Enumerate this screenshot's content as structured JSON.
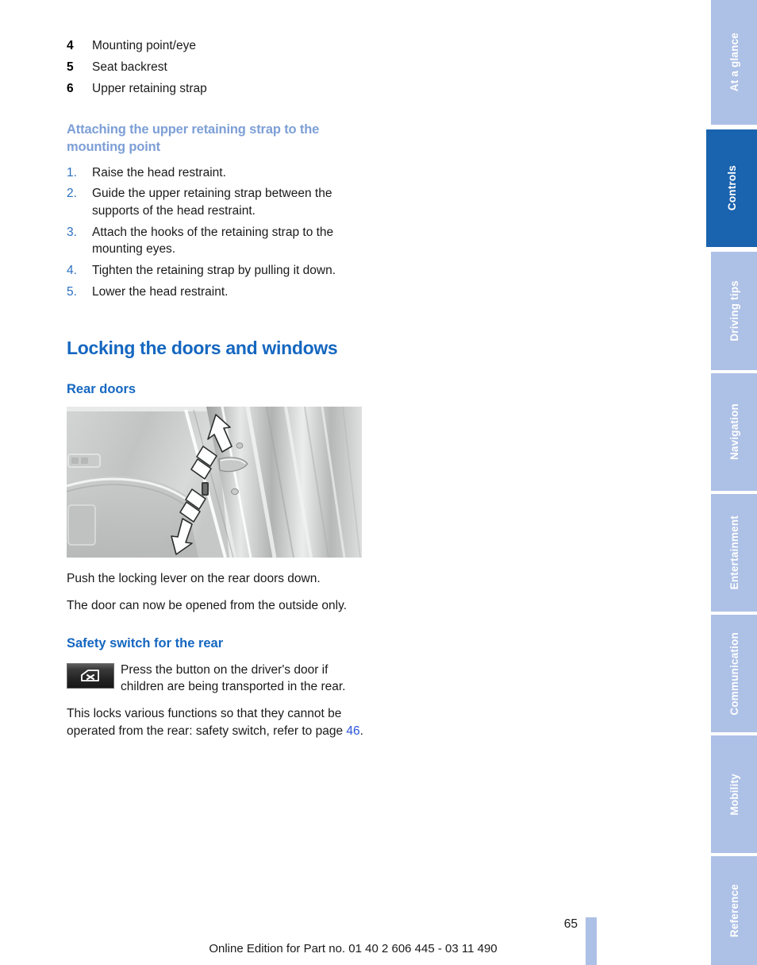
{
  "document": {
    "page_number": "65",
    "edition_line": "Online Edition for Part no. 01 40 2 606 445 - 03 11 490"
  },
  "colors": {
    "major_heading": "#1567c0",
    "section_heading": "#1567c0",
    "light_heading": "#7d9fd6",
    "step_number": "#2a6fc0",
    "active_tab": "#1a63ae",
    "inactive_tab": "#adc0e6",
    "link": "#2b53d8",
    "body_text": "#1a1a1a"
  },
  "legend": {
    "items": [
      {
        "number": "4",
        "label": "Mounting point/eye"
      },
      {
        "number": "5",
        "label": "Seat backrest"
      },
      {
        "number": "6",
        "label": "Upper retaining strap"
      }
    ]
  },
  "strap_section": {
    "heading": "Attaching the upper retaining strap to the mounting point",
    "steps": [
      {
        "number": "1.",
        "text": "Raise the head restraint."
      },
      {
        "number": "2.",
        "text": "Guide the upper retaining strap between the supports of the head restraint."
      },
      {
        "number": "3.",
        "text": "Attach the hooks of the retaining strap to the mounting eyes."
      },
      {
        "number": "4.",
        "text": "Tighten the retaining strap by pulling it down."
      },
      {
        "number": "5.",
        "text": "Lower the head restraint."
      }
    ]
  },
  "locking_section": {
    "heading": "Locking the doors and windows",
    "rear_doors": {
      "heading": "Rear doors",
      "figure_name": "rear-door-locking-lever-photo",
      "paragraphs": [
        "Push the locking lever on the rear doors down.",
        "The door can now be opened from the outside only."
      ]
    },
    "safety_switch": {
      "heading": "Safety switch for the rear",
      "icon_name": "child-safety-lock-button-icon",
      "icon_paragraph": "Press the button on the driver's door if children are being transported in the rear.",
      "closing_paragraph_before": "This locks various functions so that they cannot be operated from the rear: safety switch, refer to page ",
      "closing_paragraph_link": "46",
      "closing_paragraph_after": "."
    }
  },
  "rail": {
    "tabs": [
      {
        "label": "At a glance",
        "active": false
      },
      {
        "label": "Controls",
        "active": true
      },
      {
        "label": "Driving tips",
        "active": false
      },
      {
        "label": "Navigation",
        "active": false
      },
      {
        "label": "Entertainment",
        "active": false
      },
      {
        "label": "Communication",
        "active": false
      },
      {
        "label": "Mobility",
        "active": false
      },
      {
        "label": "Reference",
        "active": false
      }
    ]
  }
}
